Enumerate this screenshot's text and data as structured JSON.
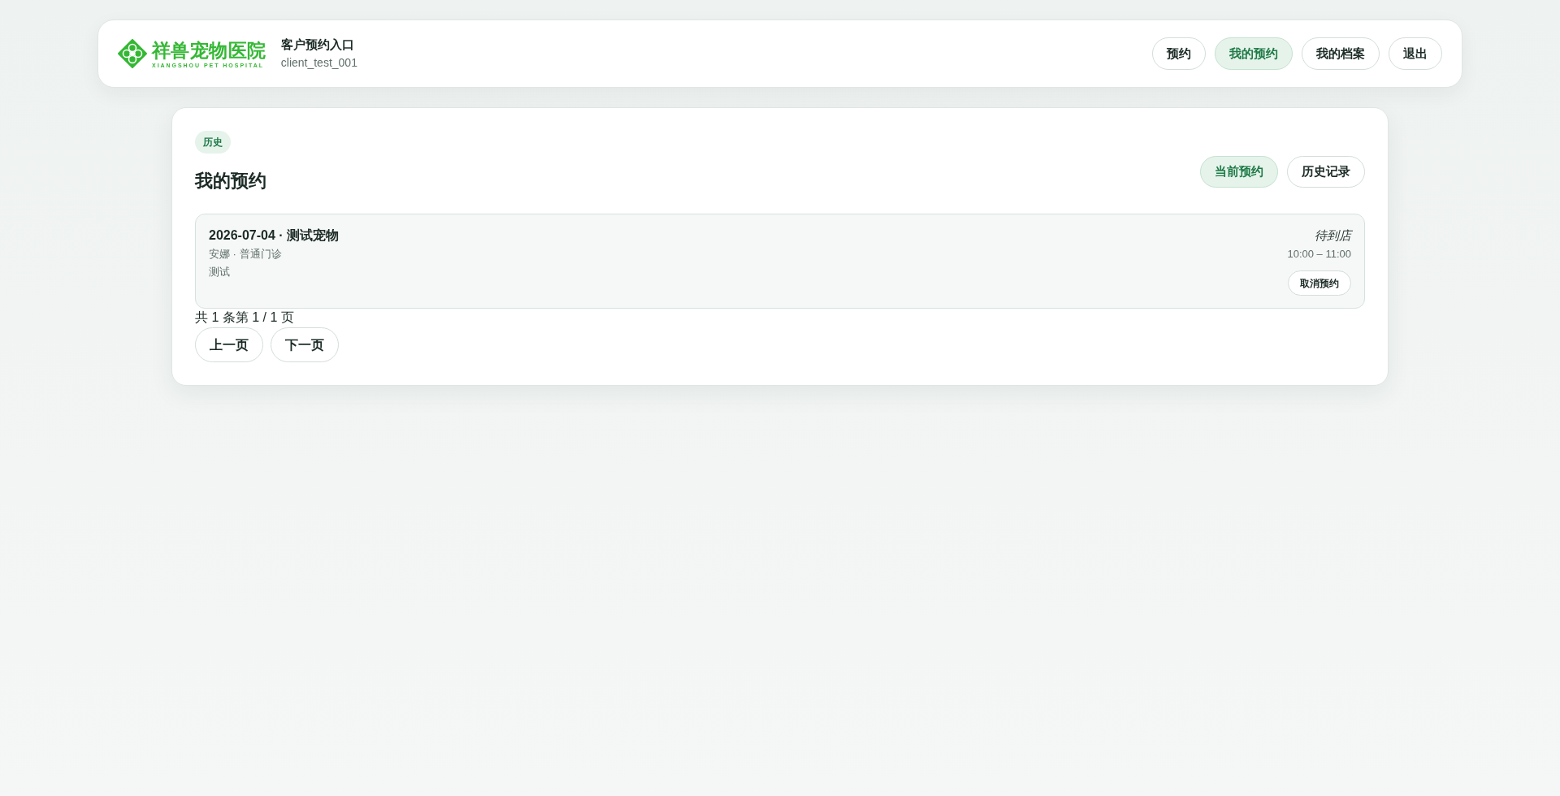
{
  "header": {
    "logo": {
      "name": "祥兽宠物医院",
      "subtitle": "XIANGSHOU PET HOSPITAL"
    },
    "title": "客户预约入口",
    "user": "client_test_001",
    "nav": [
      {
        "label": "预约",
        "selected": false
      },
      {
        "label": "我的预约",
        "selected": true
      },
      {
        "label": "我的档案",
        "selected": false
      },
      {
        "label": "退出",
        "selected": false
      }
    ]
  },
  "main": {
    "badge": "历史",
    "title": "我的预约",
    "tabs": [
      {
        "label": "当前预约",
        "selected": true
      },
      {
        "label": "历史记录",
        "selected": false
      }
    ],
    "appointments": [
      {
        "title": "2026-07-04 · 测试宠物",
        "details": "安娜 · 普通门诊",
        "note": "测试",
        "status": "待到店",
        "time": "10:00 – 11:00",
        "action": "取消预约"
      }
    ],
    "pagination": {
      "summary": "共 1 条第 1 / 1 页",
      "buttons": [
        "上一页",
        "下一页"
      ]
    }
  }
}
